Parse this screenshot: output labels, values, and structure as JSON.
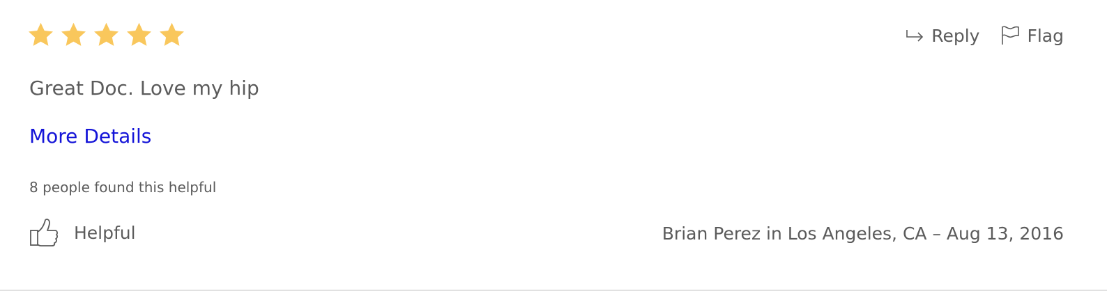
{
  "review": {
    "rating": 5,
    "rating_max": 5,
    "star_color": "#f9c75c",
    "text": "Great Doc. Love my hip",
    "more_link": "More Details",
    "link_color": "#1414d8",
    "helpful_count_text": "8 people found this helpful",
    "helpful_label": "Helpful",
    "byline": "Brian Perez in Los Angeles, CA – Aug 13, 2016"
  },
  "actions": {
    "reply_label": "Reply",
    "reply_icon": "reply-arrow-icon",
    "flag_label": "Flag",
    "flag_icon": "flag-icon"
  },
  "icons": {
    "star": "star-icon",
    "thumb": "thumbs-up-icon"
  }
}
